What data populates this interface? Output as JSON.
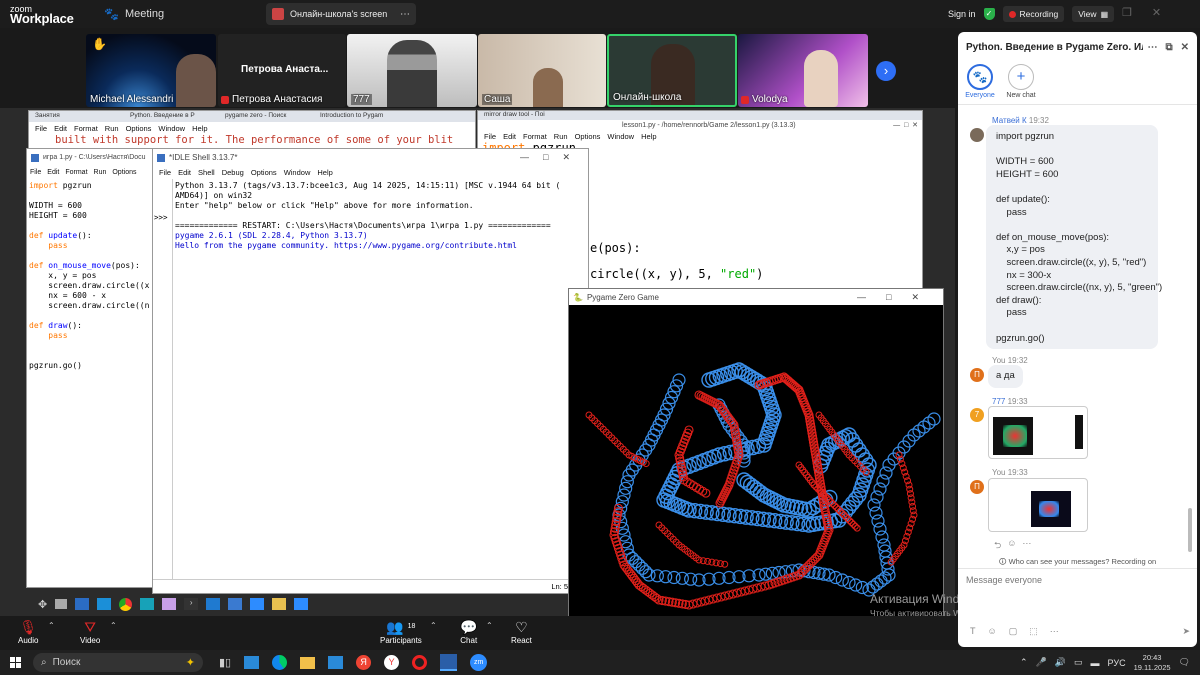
{
  "topbar": {
    "logo_small": "zoom",
    "logo_big": "Workplace",
    "meeting_label": "Meeting",
    "share_label": "Онлайн-школа's screen",
    "sign_in": "Sign in",
    "recording": "Recording",
    "view": "View"
  },
  "participants": [
    {
      "name": "Michael Alessandri"
    },
    {
      "name": "Петрова Анастасия",
      "big_name": "Петрова  Анаста..."
    },
    {
      "name": "777"
    },
    {
      "name": "Саша"
    },
    {
      "name": "Онлайн-школа"
    },
    {
      "name": "Volodya"
    }
  ],
  "desktop": {
    "top_tabs": [
      "Занятия",
      "Python. Введение в Р",
      "pygame zero - Поиск",
      "Introduction to Pygam",
      "mirror draw tool - Поі"
    ],
    "browser_text": "built with support for it. The performance of some of your blit",
    "editor_right": {
      "title": "lesson1.py - /home/rennorb/Game 2/lesson1.py (3.13.3)",
      "menu": [
        "File",
        "Edit",
        "Format",
        "Run",
        "Options",
        "Window",
        "Help"
      ],
      "line1": "import pgzrun",
      "line2": "e(pos):",
      "line3a": "circle((x, y), 5, ",
      "line3b": "\"red\"",
      "line3c": ")"
    },
    "editor_left": {
      "title": "игра 1.py - C:\\Users\\Настя\\Docu",
      "menu": [
        "File",
        "Edit",
        "Format",
        "Run",
        "Options"
      ],
      "lines": [
        "import pgzrun",
        "",
        "WIDTH = 600",
        "HEIGHT = 600",
        "",
        "def update():",
        "    pass",
        "",
        "def on_mouse_move(pos):",
        "    x, y = pos",
        "    screen.draw.circle((x",
        "    nx = 600 - x",
        "    screen.draw.circle((n",
        "",
        "def draw():",
        "    pass",
        "",
        "",
        "pgzrun.go()"
      ]
    },
    "shell": {
      "title": "*IDLE Shell 3.13.7*",
      "menu": [
        "File",
        "Edit",
        "Shell",
        "Debug",
        "Options",
        "Window",
        "Help"
      ],
      "prompt": ">>>",
      "lines": [
        "Python 3.13.7 (tags/v3.13.7:bcee1c3, Aug 14 2025, 14:15:11) [MSC v.1944 64 bit (",
        "AMD64)] on win32",
        "Enter \"help\" below or click \"Help\" above for more information.",
        "",
        "============= RESTART: C:\\Users\\Настя\\Documents\\игра 1\\игра 1.py =============",
        "pygame 2.6.1 (SDL 2.28.4, Python 3.13.7)",
        "Hello from the pygame community. https://www.pygame.org/contribute.html"
      ],
      "status": "Ln: 5"
    },
    "game": {
      "title": "Pygame Zero Game",
      "red_color": "#e0201a",
      "blue_color": "#3a8ee8"
    },
    "activation_title": "Активация Windows",
    "activation_sub": "Чтобы активировать Windows, перейдите в раздел \"Параметры\"."
  },
  "chat": {
    "title": "Python. Введение в Pygame Zero. Илья Б...",
    "everyone_label": "Everyone",
    "newchat_label": "New chat",
    "messages": [
      {
        "sender": "Матвей К",
        "time": "19:32",
        "text": "import pgzrun\n\nWIDTH = 600\nHEIGHT = 600\n\ndef update():\n    pass\n\ndef on_mouse_move(pos):\n    x,y = pos\n    screen.draw.circle((x, y), 5, \"red\")\n    nx = 300-x\n    screen.draw.circle((nx, y), 5, \"green\")\ndef draw():\n    pass\n\npgzrun.go()"
      },
      {
        "sender": "You",
        "time": "19:32",
        "avatar": "П",
        "text": "а да"
      },
      {
        "sender": "777",
        "time": "19:33",
        "avatar": "7"
      },
      {
        "sender": "You",
        "time": "19:33",
        "avatar": "П"
      }
    ],
    "privacy": "Who can see your messages? Recording on",
    "placeholder": "Message everyone"
  },
  "controls": {
    "audio": "Audio",
    "video": "Video",
    "participants": "Participants",
    "participants_count": "18",
    "chat": "Chat",
    "react": "React"
  },
  "taskbar": {
    "search": "Поиск",
    "lang": "РУС",
    "time": "20:43",
    "date": "19.11.2025"
  }
}
